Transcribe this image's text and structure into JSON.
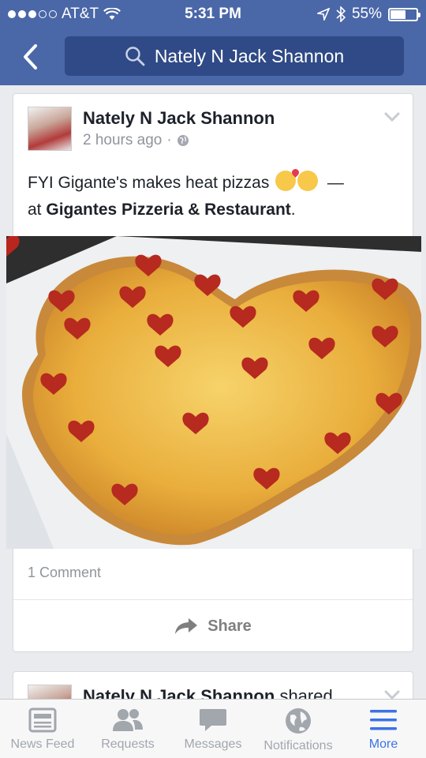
{
  "status_bar": {
    "carrier": "AT&T",
    "time": "5:31 PM",
    "battery": "55%",
    "battery_level": 0.55,
    "icons": [
      "signal-dots-icon",
      "wifi-icon",
      "location-arrow-icon",
      "bluetooth-icon",
      "battery-icon"
    ]
  },
  "header": {
    "search_text": "Nately N Jack Shannon",
    "back_icon": "chevron-left-icon",
    "search_icon": "search-icon"
  },
  "post": {
    "author": "Nately N Jack Shannon",
    "time": "2 hours ago",
    "separator": "·",
    "privacy_icon": "globe-icon",
    "text_prefix": "FYI Gigante's  makes heat pizzas",
    "text_dash": "—",
    "text_at": "at",
    "place": "Gigantes Pizzeria & Restaurant",
    "text_end": ".",
    "emojis": [
      "kissing-face-emoji",
      "smiling-face-emoji"
    ],
    "photo": "heart-shaped-pizza-photo",
    "comments": "1 Comment",
    "share_label": "Share"
  },
  "next_post": {
    "author": "Nately N Jack Shannon",
    "action": "shared"
  },
  "tabs": [
    {
      "label": "News Feed",
      "icon": "news-feed-icon",
      "active": false
    },
    {
      "label": "Requests",
      "icon": "friend-requests-icon",
      "active": false
    },
    {
      "label": "Messages",
      "icon": "messages-icon",
      "active": false
    },
    {
      "label": "Notifications",
      "icon": "globe-icon",
      "active": false
    },
    {
      "label": "More",
      "icon": "menu-icon",
      "active": true
    }
  ],
  "colors": {
    "header": "#4a67a8",
    "search": "#2f4a86",
    "active_tab": "#3b73e6",
    "inactive_tab": "#a2a6ad"
  }
}
